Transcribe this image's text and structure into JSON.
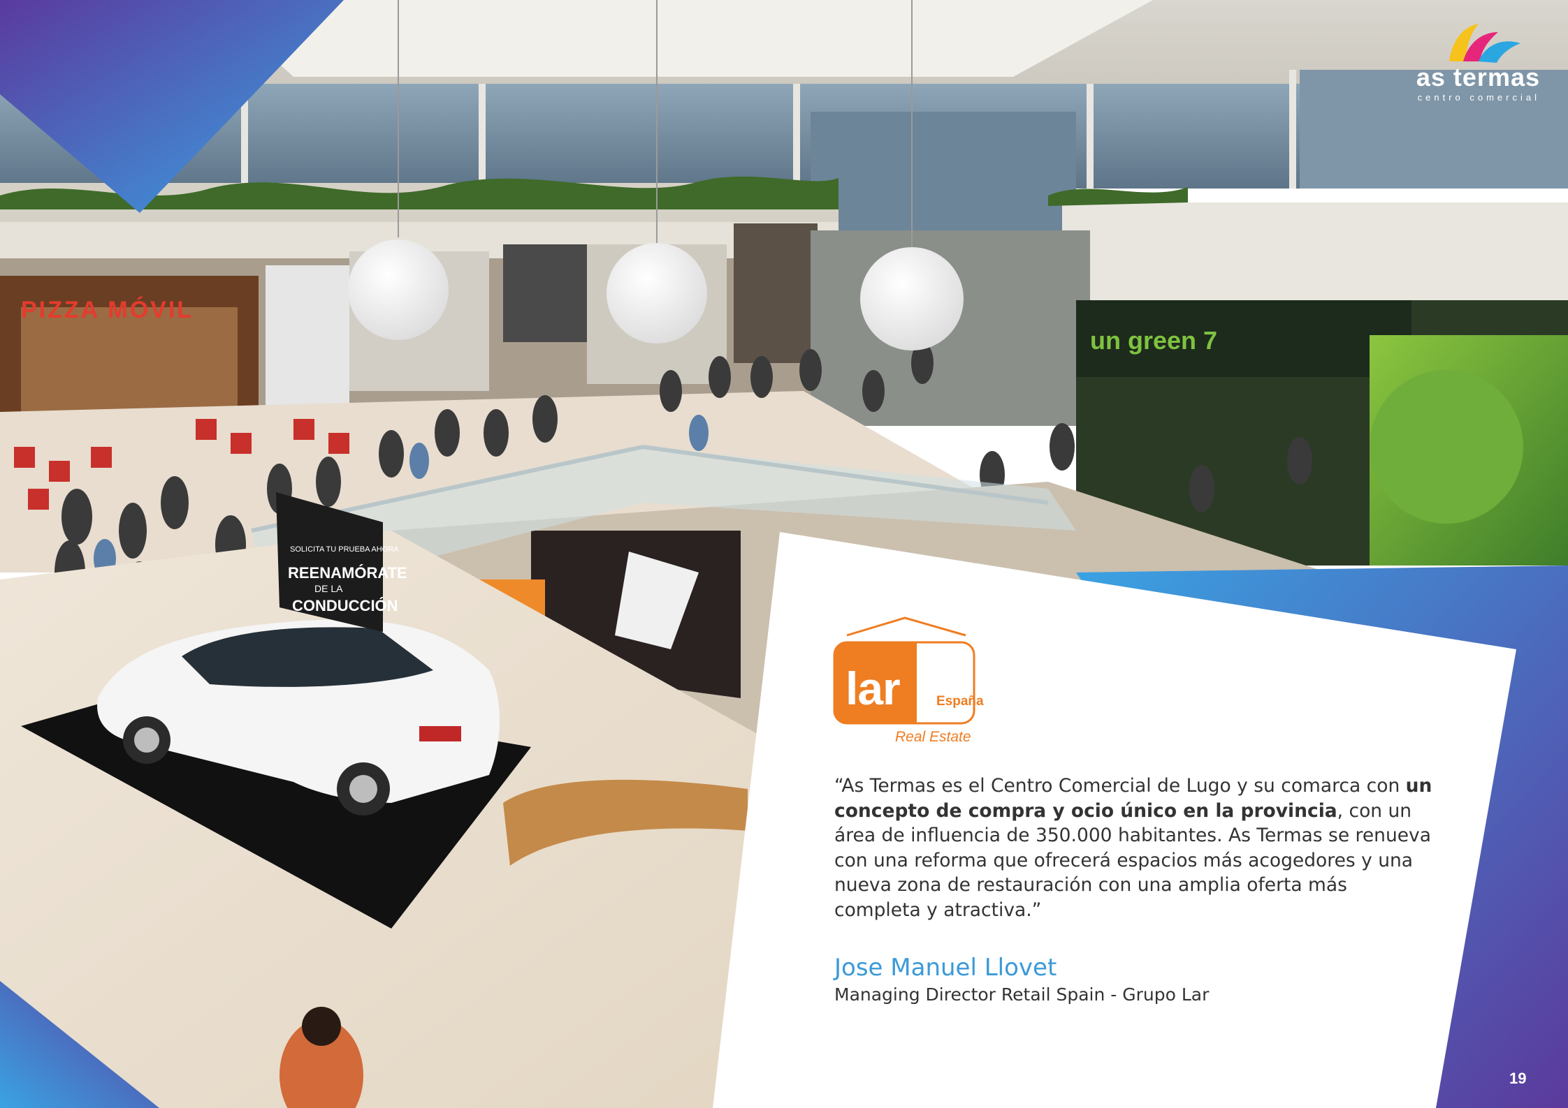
{
  "brand": {
    "name": "as termas",
    "tagline": "centro comercial"
  },
  "photo": {
    "storefront_sign": "PIZZA MÓVIL",
    "promo_banner_lines": [
      "SOLICITA TU PRUEBA AHORA",
      "REENAMÓRATE",
      "DE LA",
      "CONDUCCIÓN"
    ],
    "green_store_sign": "un green 7"
  },
  "lar": {
    "wordmark": "lar",
    "country": "España",
    "subtitle": "Real Estate"
  },
  "quote": {
    "part1": "“As Termas es el Centro Comercial de Lugo y su comarca con ",
    "bold": "un concepto de compra y ocio único en la provincia",
    "part2": ", con un área de influencia de 350.000 habitantes. As Termas se renueva con una reforma que ofrecerá  espacios más acogedores y una nueva zona de restauración con una amplia oferta más completa y atractiva.”"
  },
  "author": {
    "name": "Jose Manuel Llovet",
    "role": "Managing Director Retail Spain - Grupo Lar"
  },
  "page_number": "19",
  "colors": {
    "gradient_start": "#3aa3e3",
    "gradient_end": "#5b3a9c",
    "lar_orange": "#ef7d22",
    "author_blue": "#3b9ad8"
  }
}
